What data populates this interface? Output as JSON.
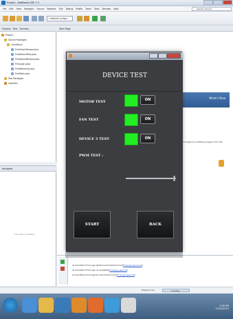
{
  "window": {
    "title": "Project - NetBeans IDE 7.1"
  },
  "menu": [
    "File",
    "Edit",
    "View",
    "Navigate",
    "Source",
    "Refactor",
    "Run",
    "Debug",
    "Profile",
    "Team",
    "Tools",
    "Window",
    "Help"
  ],
  "search": {
    "placeholder": "Search (Ctrl+I)"
  },
  "toolbar": {
    "config_value": "<default config>"
  },
  "projects_panel": {
    "tabs": [
      "Projects",
      "Files",
      "Services"
    ],
    "tree": [
      {
        "label": "Project",
        "level": 0
      },
      {
        "label": "Source Packages",
        "level": 1
      },
      {
        "label": "ClientPack",
        "level": 2
      },
      {
        "label": "FrmCheckSensor.java",
        "level": 3
      },
      {
        "label": "FrmDeviceTest.java",
        "level": 3
      },
      {
        "label": "FrmHomeWindow.java",
        "level": 3
      },
      {
        "label": "FrmLogin.java",
        "level": 3
      },
      {
        "label": "FrmWelcome.java",
        "level": 3
      },
      {
        "label": "FrmMain.java",
        "level": 3
      },
      {
        "label": "Test Packages",
        "level": 1
      },
      {
        "label": "Libraries",
        "level": 1
      }
    ]
  },
  "navigator": {
    "title": "Navigator",
    "empty_text": "<No View Available>"
  },
  "editor": {
    "tab_label": "Start Page",
    "whats_new": "What's New",
    "startpage_text": "Add technologies by installing plugins from the"
  },
  "output": {
    "lines": [
      {
        "prefix": "at ClientPack.FrmLogin.jButton1ActionPerformed(",
        "link": "FrmLogin.java:110",
        "suffix": ")"
      },
      {
        "prefix": "at ClientPack.FrmLogin.access$000(",
        "link": "FrmLogin.java:16",
        "suffix": ")"
      },
      {
        "prefix": "at ClientPack.FrmLogin$1.actionPerformed(",
        "link": "FrmLogin.java:76",
        "suffix": ")"
      }
    ]
  },
  "statusbar": {
    "status": "Project (run)",
    "progress_label": "running..."
  },
  "taskbar": {
    "time": "3:50 PM",
    "date": "12/10/2013"
  },
  "dialog": {
    "heading": "DEVICE TEST",
    "tests": [
      {
        "label": "MOTOR TEST",
        "button": "ON",
        "status_color": "#22ee22"
      },
      {
        "label": "FAN TEST",
        "button": "ON",
        "status_color": "#22ee22"
      },
      {
        "label": "DEVICE 3 TEST",
        "button": "ON",
        "status_color": "#22ee22"
      }
    ],
    "pwm_label": "PWM TEST :",
    "pwm_value_fraction": 0.97,
    "start_label": "START",
    "back_label": "BACK"
  },
  "colors": {
    "status_on": "#22ee22",
    "dialog_bg": "#3c3d40",
    "titlebar": "#9ea9b7"
  }
}
